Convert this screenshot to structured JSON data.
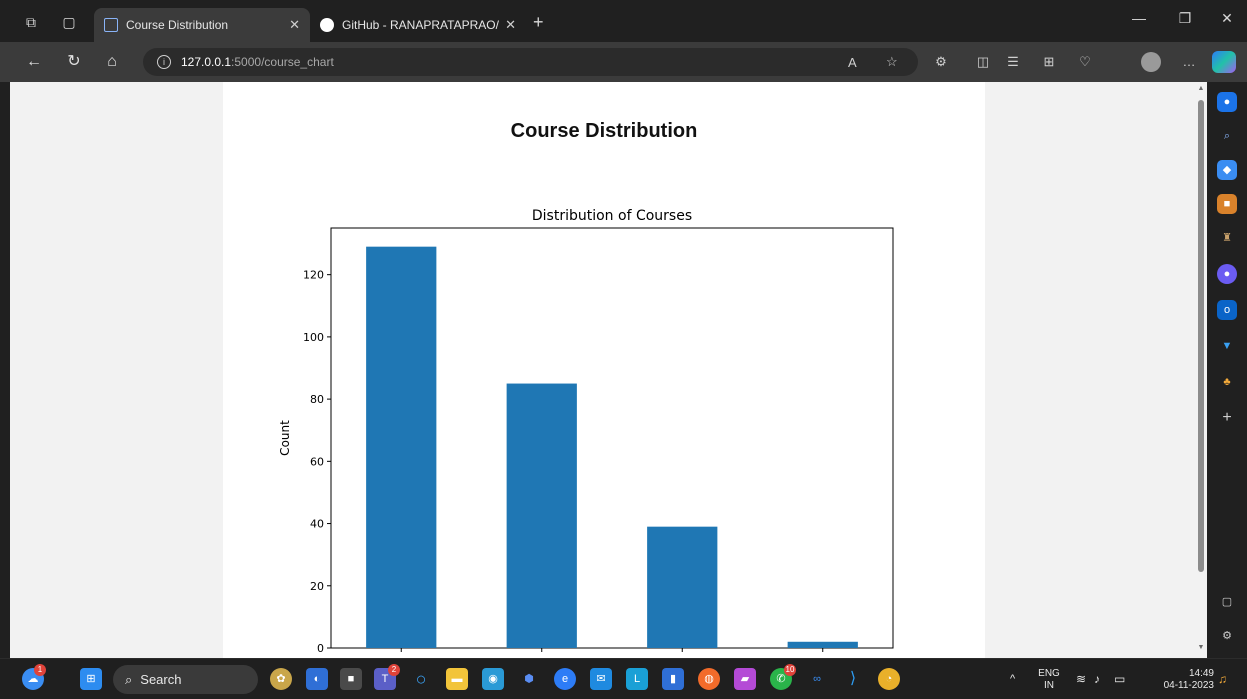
{
  "browser": {
    "tabs": [
      {
        "title": "Course Distribution",
        "active": true,
        "favicon": "page-icon"
      },
      {
        "title": "GitHub - RANAPRATAPRAO/Data",
        "active": false,
        "favicon": "github-icon"
      }
    ],
    "url_host": "127.0.0.1",
    "url_path": ":5000/course_chart"
  },
  "page": {
    "heading": "Course Distribution"
  },
  "chart_data": {
    "type": "bar",
    "title": "Distribution of Courses",
    "xlabel": "",
    "ylabel": "Count",
    "categories": [
      "",
      "",
      "",
      ""
    ],
    "values": [
      129,
      85,
      39,
      2
    ],
    "ylim": [
      0,
      135
    ],
    "yticks": [
      0,
      20,
      40,
      60,
      80,
      100,
      120
    ],
    "grid": false,
    "bar_color": "#1f77b4"
  },
  "taskbar": {
    "search_label": "Search",
    "notification_count": "1",
    "teams_badge": "2",
    "whatsapp_badge": "10",
    "language": "ENG",
    "region": "IN",
    "time": "14:49",
    "date": "04-11-2023"
  },
  "colors": {
    "accent": "#1f77b4",
    "chrome_dark": "#202020",
    "tab_active": "#3b3b3b"
  }
}
